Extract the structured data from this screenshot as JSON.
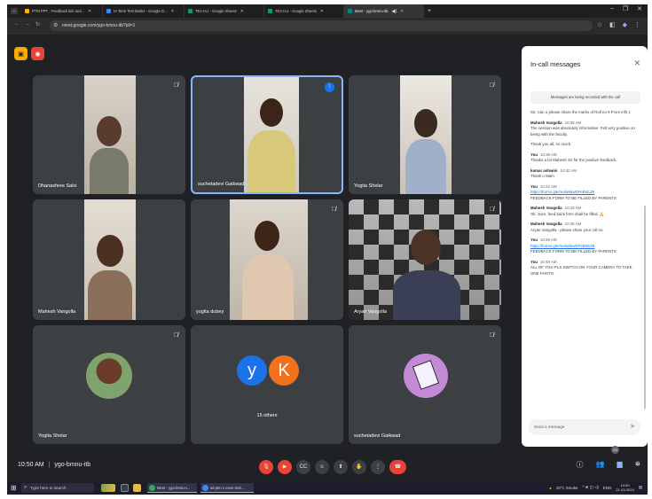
{
  "browser": {
    "tabs": [
      {
        "label": "PTM PPT , Feedback link and...",
        "favicon_color": "#f4b400"
      },
      {
        "label": "IA Term Test Marks - Google D...",
        "favicon_color": "#4285f4"
      },
      {
        "label": "TE1-IA1 - Google Sheets",
        "favicon_color": "#0f9d58"
      },
      {
        "label": "TE2-IA1 - Google Sheets",
        "favicon_color": "#0f9d58"
      },
      {
        "label": "Meet - ygo-bmnu-itb",
        "favicon_color": "#00897b"
      }
    ],
    "new_tab": "+",
    "url": "meet.google.com/ygo-bmnu-itb?pli=1"
  },
  "meet": {
    "participants": [
      {
        "name": "Dhanashree Salvi",
        "muted": true,
        "speaking": false
      },
      {
        "name": "suchetadevi Gaikwad",
        "muted": false,
        "speaking": true
      },
      {
        "name": "Yogita Shelar",
        "muted": true,
        "speaking": false
      },
      {
        "name": "Mahesh Vangolla",
        "muted": false,
        "speaking": false
      },
      {
        "name": "yogita dubey",
        "muted": true,
        "speaking": false
      },
      {
        "name": "Aryan Vangolla",
        "muted": true,
        "speaking": false
      },
      {
        "name": "Yogita Shelar",
        "muted": true,
        "speaking": false
      },
      {
        "name": "15 others",
        "muted": false,
        "speaking": false,
        "letters": [
          "y",
          "K"
        ]
      },
      {
        "name": "suchetadevi Gaikwad",
        "muted": true,
        "speaking": false
      }
    ],
    "time": "10:50 AM",
    "meeting_code": "ygo-bmnu-itb",
    "participant_count": "23"
  },
  "chat": {
    "title": "In-call messages",
    "recording_note": "Messages are being recorded with the call",
    "messages": [
      {
        "who": "",
        "time": "",
        "text": "Sir, Can u please share the marks of Roll no 9 From infit 1",
        "link": ""
      },
      {
        "who": "Mahesh Vangolla",
        "time": "10:35 AM",
        "text": "The session was absolutely informative. Felt very positive on being with the faculty.",
        "link": ""
      },
      {
        "who": "",
        "time": "",
        "text": "Thank you all, so much.",
        "link": ""
      },
      {
        "who": "You",
        "time": "10:38 AM",
        "text": "Thanks a lot Mahesh Sir for the positive feedback.",
        "link": ""
      },
      {
        "who": "kumar ashwini",
        "time": "10:42 AM",
        "text": "Thank u Mam",
        "link": ""
      },
      {
        "who": "You",
        "time": "10:42 AM",
        "text": "FEEDBACK FORM TO BE FILLED BY PARENTS",
        "link": "https://forms.gle/realiwlawDFeBnEZ8"
      },
      {
        "who": "Mahesh Vangolla",
        "time": "10:43 AM",
        "text": "Ok. Sure, feed back form shall be filled. 🙏",
        "link": ""
      },
      {
        "who": "Mahesh Vangolla",
        "time": "10:45 AM",
        "text": "Aryan Vangolla - please share your roll no.",
        "link": ""
      },
      {
        "who": "You",
        "time": "10:46 AM",
        "text": "FEEDBACK FORM TO BE FILLED BY PARENTS",
        "link": "https://forms.gle/realiwlawDFeBnEZ8"
      },
      {
        "who": "You",
        "time": "10:48 AM",
        "text": "ALL OF YOU PLS SWITCH ON YOUR CAMERA TO TAKE ONE PHOTO",
        "link": ""
      }
    ],
    "send_placeholder": "Send a message"
  },
  "taskbar": {
    "search_placeholder": "Type here to search",
    "apps": [
      "Meet - ygo-bmnu-i...",
      "sd ptm 1 even sem..."
    ],
    "weather": "18°C  Smoke",
    "lang": "ENG",
    "clock_time": "10:50",
    "clock_date": "21-03-2024"
  },
  "colors": {
    "meet_bg": "#202124",
    "tile_bg": "#3c4043",
    "speaking_border": "#8ab4f8",
    "end_call": "#ea4335",
    "letter_y": "#1a73e8",
    "letter_k": "#f2711c"
  }
}
